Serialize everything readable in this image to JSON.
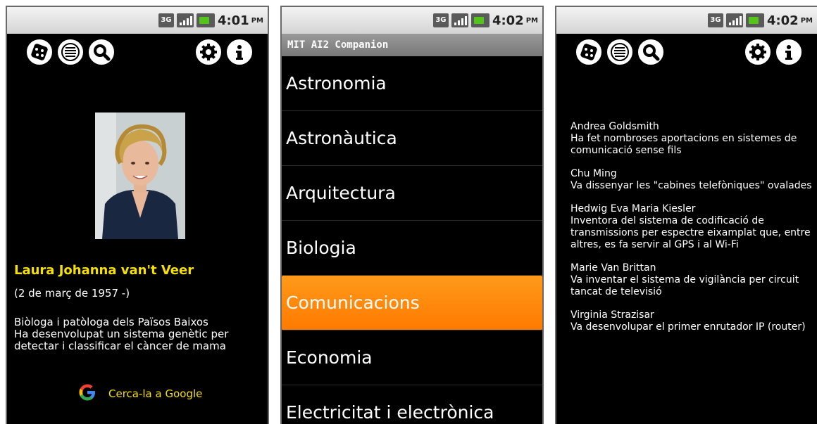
{
  "screens": [
    {
      "status": {
        "network": "3G",
        "time": "4:01",
        "ampm": "PM"
      },
      "toolbar": {
        "icons": [
          "dice-icon",
          "list-icon",
          "search-icon",
          "gear-icon",
          "info-icon"
        ]
      },
      "person": {
        "name": "Laura Johanna van't Veer",
        "dates": "(2 de març de 1957 -)",
        "description_line1": "Biòloga i patòloga dels Països Baixos",
        "description_line2": "Ha desenvolupat un sistema genètic per detectar i classificar el càncer de mama"
      },
      "google": {
        "label": "Cerca-la a Google",
        "letter": "G"
      }
    },
    {
      "status": {
        "network": "3G",
        "time": "4:02",
        "ampm": "PM"
      },
      "title": "MIT AI2 Companion",
      "categories": [
        {
          "label": "Astronomia",
          "selected": false
        },
        {
          "label": "Astronàutica",
          "selected": false
        },
        {
          "label": "Arquitectura",
          "selected": false
        },
        {
          "label": "Biologia",
          "selected": false
        },
        {
          "label": "Comunicacions",
          "selected": true
        },
        {
          "label": "Economia",
          "selected": false
        },
        {
          "label": "Electricitat i electrònica",
          "selected": false
        }
      ],
      "colors": {
        "selected": "#ff8800"
      }
    },
    {
      "status": {
        "network": "3G",
        "time": "4:02",
        "ampm": "PM"
      },
      "toolbar": {
        "icons": [
          "dice-icon",
          "list-icon",
          "search-icon",
          "gear-icon",
          "info-icon"
        ]
      },
      "people": [
        {
          "name": "Andrea Goldsmith",
          "description": "Ha fet nombroses aportacions en sistemes de comunicació sense fils"
        },
        {
          "name": "Chu Ming",
          "description": "Va dissenyar les \"cabines telefòniques\" ovalades"
        },
        {
          "name": "Hedwig Eva Maria Kiesler",
          "description": "Inventora del sistema de codificació de transmissions per espectre eixamplat que, entre altres, es fa servir al GPS i al Wi-Fi"
        },
        {
          "name": "Marie Van Brittan",
          "description": "Va inventar el sistema de vigilància per circuit tancat de televisió"
        },
        {
          "name": "Virginia Strazisar",
          "description": "Va desenvolupar el primer enrutador IP (router)"
        }
      ]
    }
  ],
  "colors": {
    "accent_yellow": "#f5e000",
    "background": "#000000"
  }
}
